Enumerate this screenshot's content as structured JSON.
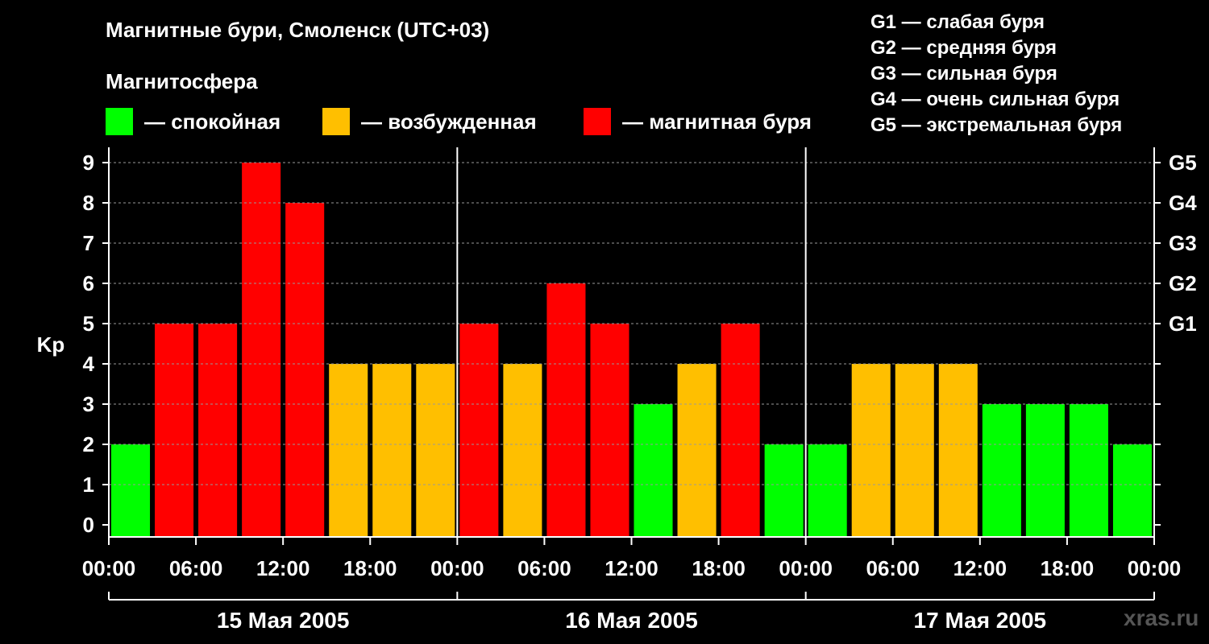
{
  "title": "Магнитные бури, Смоленск (UTC+03)",
  "subtitle": "Магнитосфера",
  "legend": [
    {
      "label": "— спокойная",
      "color": "#00ff00"
    },
    {
      "label": "— возбужденная",
      "color": "#ffbf00"
    },
    {
      "label": "— магнитная буря",
      "color": "#ff0000"
    }
  ],
  "g_legend": [
    "G1 — слабая буря",
    "G2 — средняя буря",
    "G3 — сильная буря",
    "G4 — очень сильная буря",
    "G5 — экстремальная буря"
  ],
  "watermark": "xras.ru",
  "chart_data": {
    "type": "bar",
    "ylabel": "Kp",
    "ylim": [
      0,
      9
    ],
    "y_ticks": [
      "0",
      "1",
      "2",
      "3",
      "4",
      "5",
      "6",
      "7",
      "8",
      "9"
    ],
    "right_ticks": [
      {
        "value": 5,
        "label": "G1"
      },
      {
        "value": 6,
        "label": "G2"
      },
      {
        "value": 7,
        "label": "G3"
      },
      {
        "value": 8,
        "label": "G4"
      },
      {
        "value": 9,
        "label": "G5"
      }
    ],
    "x_tick_labels": [
      "00:00",
      "06:00",
      "12:00",
      "18:00",
      "00:00",
      "06:00",
      "12:00",
      "18:00",
      "00:00",
      "06:00",
      "12:00",
      "18:00",
      "00:00"
    ],
    "days": [
      "15 Мая 2005",
      "16 Мая 2005",
      "17 Мая 2005"
    ],
    "values": [
      2,
      5,
      5,
      9,
      8,
      4,
      4,
      4,
      5,
      4,
      6,
      5,
      3,
      4,
      5,
      2,
      2,
      4,
      4,
      4,
      3,
      3,
      3,
      2
    ],
    "thresholds": {
      "quiet_max": 3,
      "active_max": 4
    },
    "grid": "dashed-horizontal"
  }
}
